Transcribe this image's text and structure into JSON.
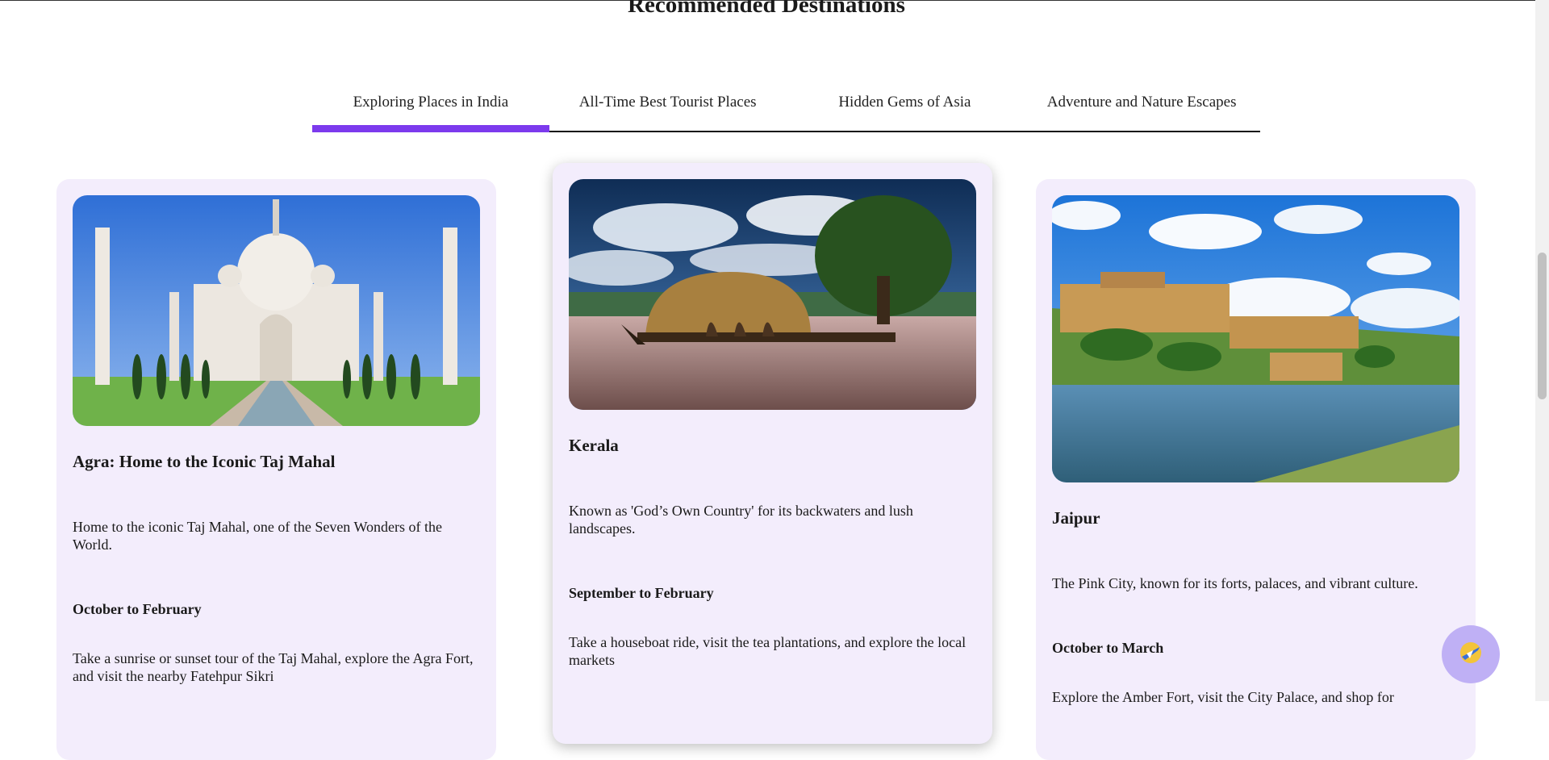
{
  "section": {
    "title": "Recommended Destinations"
  },
  "tabs": [
    {
      "label": "Exploring Places in India",
      "active": true
    },
    {
      "label": "All-Time Best Tourist Places",
      "active": false
    },
    {
      "label": "Hidden Gems of Asia",
      "active": false
    },
    {
      "label": "Adventure and Nature Escapes",
      "active": false
    }
  ],
  "cards": [
    {
      "title": "Agra: Home to the Iconic Taj Mahal",
      "description": "Home to the iconic Taj Mahal, one of the Seven Wonders of the World.",
      "season": "October to February",
      "activities": "Take a sunrise or sunset tour of the Taj Mahal, explore the Agra Fort, and visit the nearby Fatehpur Sikri",
      "image_icon": "taj-mahal-photo"
    },
    {
      "title": "Kerala",
      "description": "Known as 'God’s Own Country' for its backwaters and lush landscapes.",
      "season": "September to February",
      "activities": "Take a houseboat ride, visit the tea plantations, and explore the local markets",
      "image_icon": "houseboat-photo"
    },
    {
      "title": "Jaipur",
      "description": "The Pink City, known for its forts, palaces, and vibrant culture.",
      "season": "October to March",
      "activities": "Explore the Amber Fort, visit the City Palace, and shop for",
      "image_icon": "amber-fort-photo"
    }
  ],
  "colors": {
    "accent": "#7c3aed",
    "card_bg": "#f3edfc",
    "fab_bg": "#bfb0f5"
  },
  "fab": {
    "icon": "travel-icon"
  }
}
